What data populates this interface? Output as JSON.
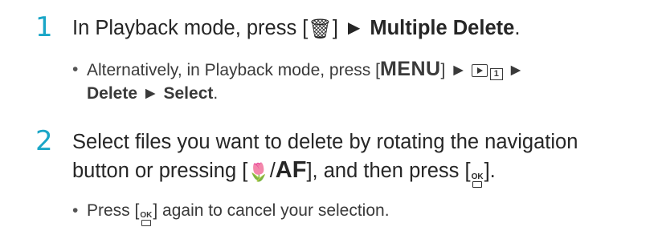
{
  "step1": {
    "number": "1",
    "prefix": "In Playback mode, press [",
    "icon_fn": "fn-trash-icon",
    "mid": "] ► ",
    "action": "Multiple Delete",
    "suffix": ".",
    "bullet": {
      "prefix": "Alternatively, in Playback mode, press [",
      "menu_key": "MENU",
      "after_menu": "] ► ",
      "tab_num": "1",
      "after_icon": " ►",
      "line2_a": "Delete",
      "line2_sep": " ► ",
      "line2_b": "Select",
      "line2_end": "."
    }
  },
  "step2": {
    "number": "2",
    "line1": "Select files you want to delete by rotating the navigation",
    "line2_prefix": "button or pressing [",
    "af_sep": "/",
    "af_label": "AF",
    "line2_mid": "], and then press [",
    "line2_end": "].",
    "ok_label": "OK",
    "bullet": {
      "prefix": "Press [",
      "ok_label": "OK",
      "suffix": "] again to cancel your selection."
    }
  },
  "colors": {
    "accent": "#1aa6c7",
    "text": "#262626"
  }
}
